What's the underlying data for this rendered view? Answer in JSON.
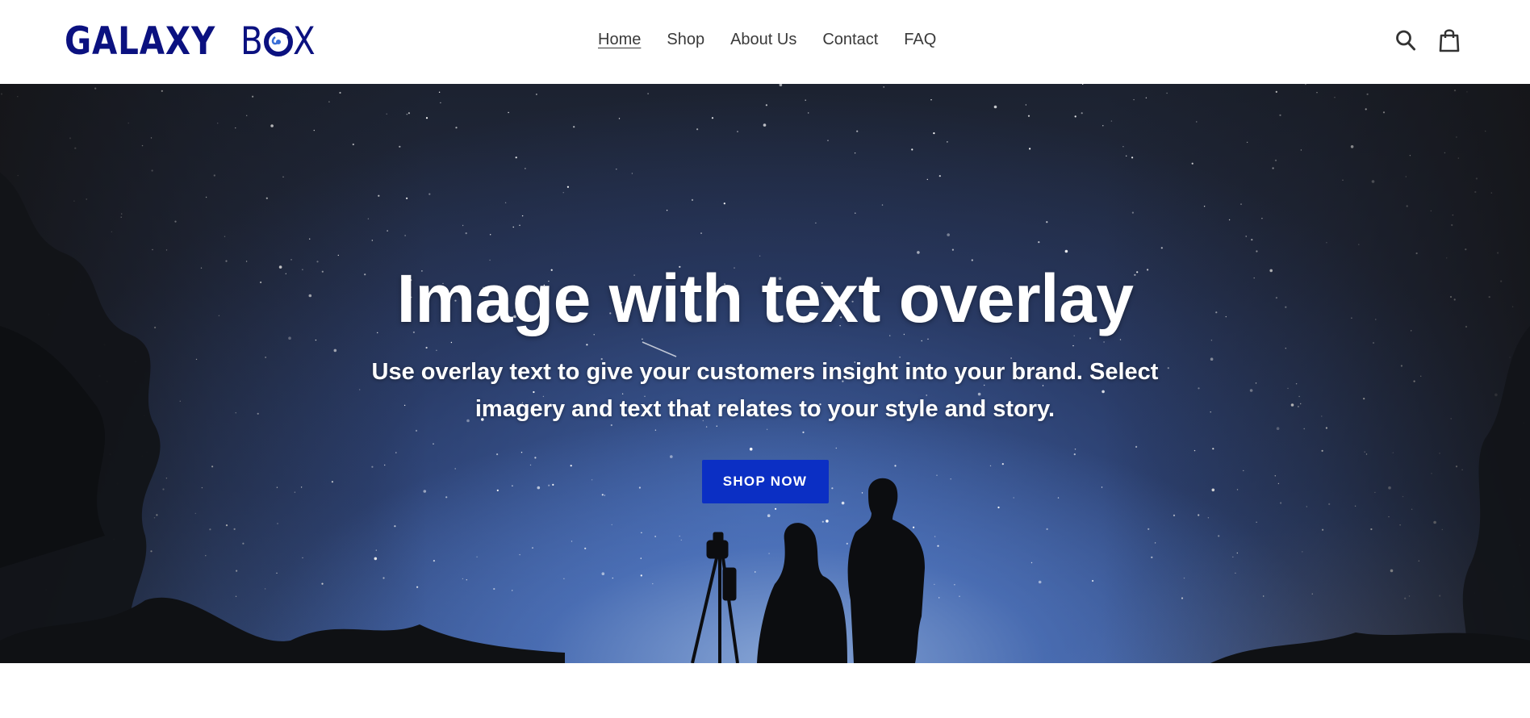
{
  "brand": {
    "logo_part1": "GALAXY",
    "logo_part2": "B",
    "logo_part3": "X",
    "color": "#0b1180"
  },
  "nav": {
    "items": [
      {
        "label": "Home",
        "active": true
      },
      {
        "label": "Shop",
        "active": false
      },
      {
        "label": "About Us",
        "active": false
      },
      {
        "label": "Contact",
        "active": false
      },
      {
        "label": "FAQ",
        "active": false
      }
    ]
  },
  "header_icons": {
    "search": "search-icon",
    "cart": "cart-icon"
  },
  "hero": {
    "title": "Image with text overlay",
    "subtitle": "Use overlay text to give your customers insight into your brand. Select imagery and text that relates to your style and story.",
    "button_label": "SHOP NOW",
    "button_color": "#0b2fc4"
  }
}
